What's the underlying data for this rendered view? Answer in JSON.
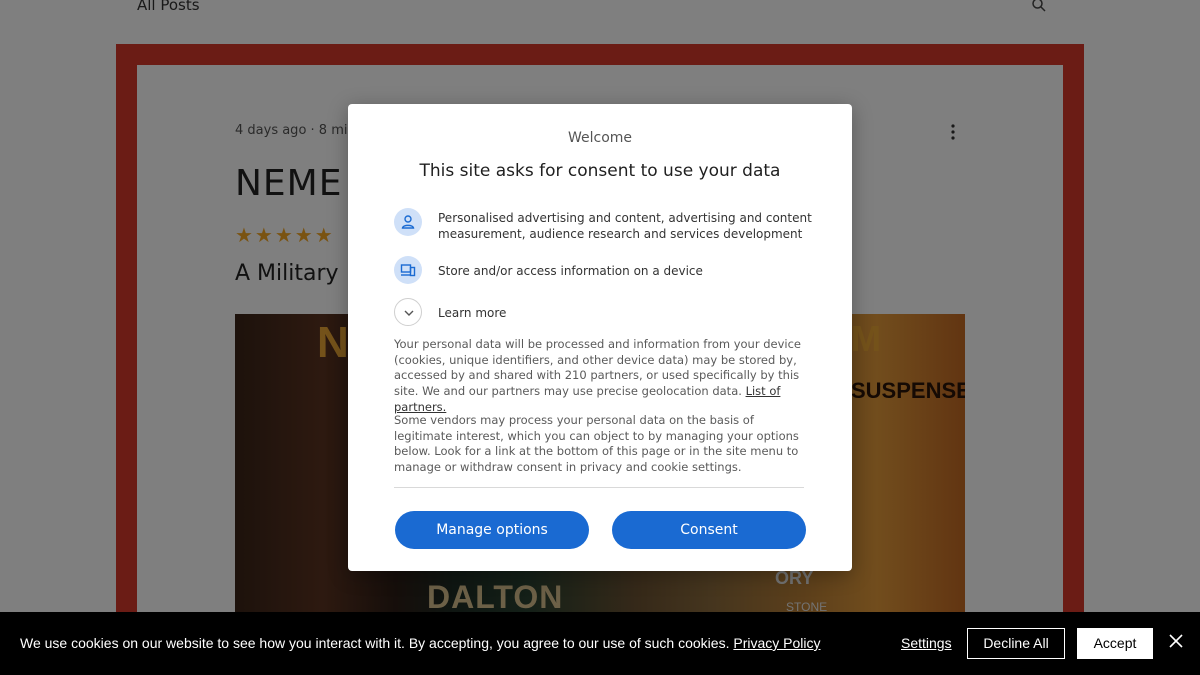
{
  "blog": {
    "nav_label": "All Posts",
    "post_meta": "4 days ago · 8 mi",
    "post_title": "NEME",
    "stars": "★★★★★",
    "subtitle": "A Military",
    "cover_texts": {
      "left": "N",
      "right": "M",
      "suspense": "SUSPENSE",
      "dalton": "DALTON",
      "ory": "ORY",
      "stone": "STONE"
    }
  },
  "dialog": {
    "welcome": "Welcome",
    "heading": "This site asks for consent to use your data",
    "purposes": [
      {
        "icon": "person-icon",
        "label": "Personalised advertising and content, advertising and content measurement, audience research and services development"
      },
      {
        "icon": "devices-icon",
        "label": "Store and/or access information on a device"
      }
    ],
    "learn_more": "Learn more",
    "para1": "Your personal data will be processed and information from your device (cookies, unique identifiers, and other device data) may be stored by, accessed by and shared with 210 partners, or used specifically by this site. We and our partners may use precise geolocation data.",
    "partners_link": "List of partners.",
    "para2": "Some vendors may process your personal data on the basis of legitimate interest, which you can object to by managing your options below. Look for a link at the bottom of this page or in the site menu to manage or withdraw consent in privacy and cookie settings.",
    "manage_label": "Manage options",
    "consent_label": "Consent",
    "accent_color": "#1a6ad2"
  },
  "cookie_bar": {
    "text": "We use cookies on our website to see how you interact with it. By accepting, you agree to our use of such cookies.",
    "privacy_link": "Privacy Policy",
    "settings_label": "Settings",
    "decline_label": "Decline All",
    "accept_label": "Accept"
  }
}
